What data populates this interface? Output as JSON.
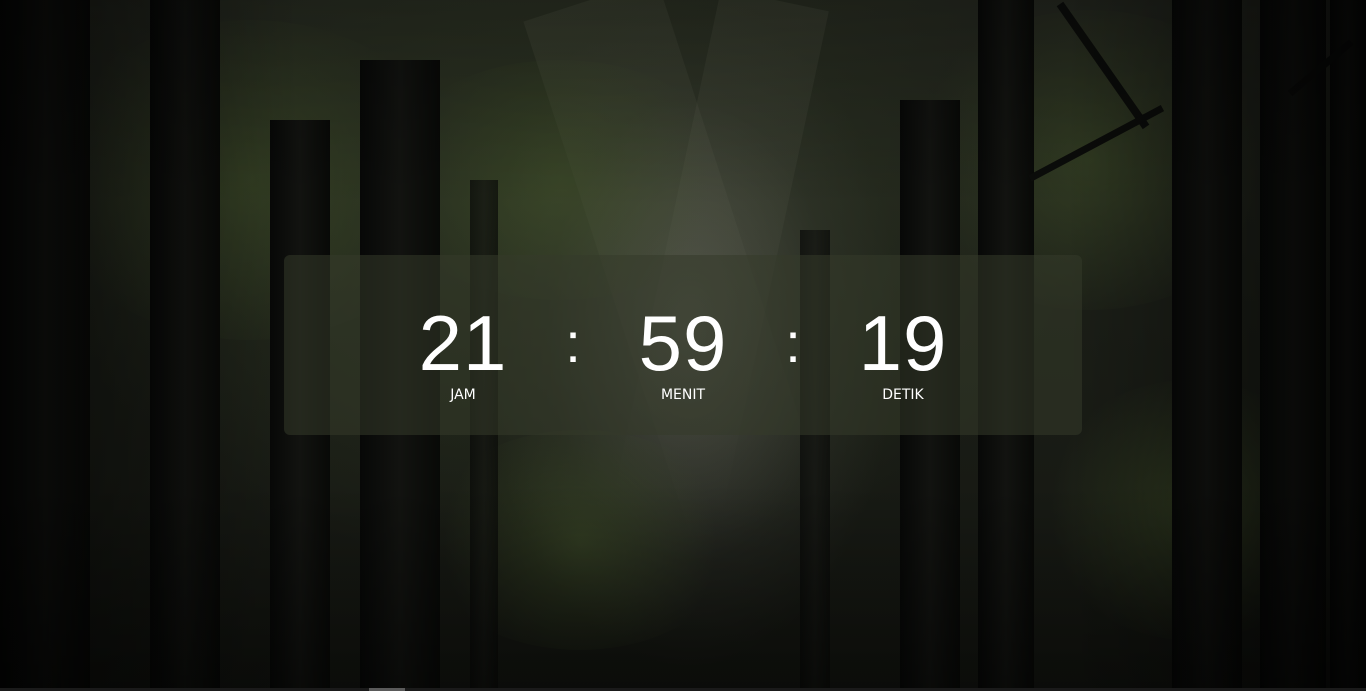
{
  "countdown": {
    "hours": {
      "value": "21",
      "label": "JAM"
    },
    "minutes": {
      "value": "59",
      "label": "MENIT"
    },
    "seconds": {
      "value": "19",
      "label": "DETIK"
    },
    "separator": ":"
  },
  "background": {
    "theme": "dark forest",
    "panel_color": "#343a2a"
  }
}
